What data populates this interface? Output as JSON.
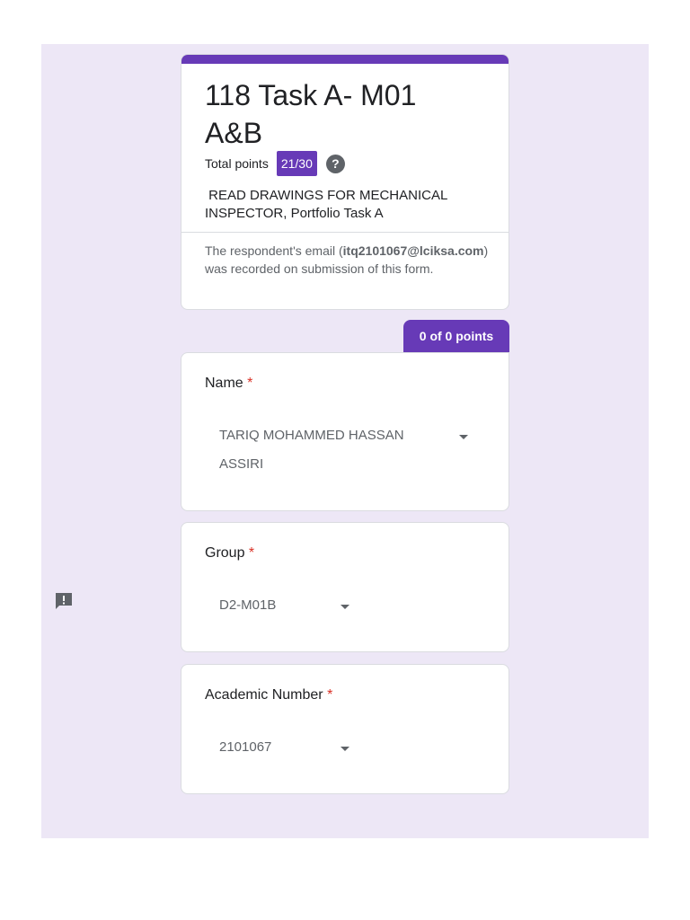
{
  "form": {
    "title": "118 Task A- M01 A&B",
    "total_points_label": "Total points",
    "score": "21/30",
    "help_icon": "help-circle-icon",
    "description": "READ DRAWINGS FOR MECHANICAL INSPECTOR, Portfolio Task A",
    "email_note": {
      "prefix": "The respondent's email (",
      "email": "itq2101067@lciksa.com",
      "suffix": ") was recorded on submission of this form."
    },
    "accent_color": "#673ab7"
  },
  "section": {
    "points": "0 of 0 points"
  },
  "questions": [
    {
      "label": "Name",
      "required_mark": "*",
      "answer_line1": "TARIQ MOHAMMED HASSAN",
      "answer_line2": "ASSIRI"
    },
    {
      "label": "Group",
      "required_mark": "*",
      "answer": "D2-M01B"
    },
    {
      "label": "Academic Number",
      "required_mark": "*",
      "answer": "2101067"
    }
  ],
  "sidebar": {
    "feedback_icon": "report-feedback-icon"
  }
}
